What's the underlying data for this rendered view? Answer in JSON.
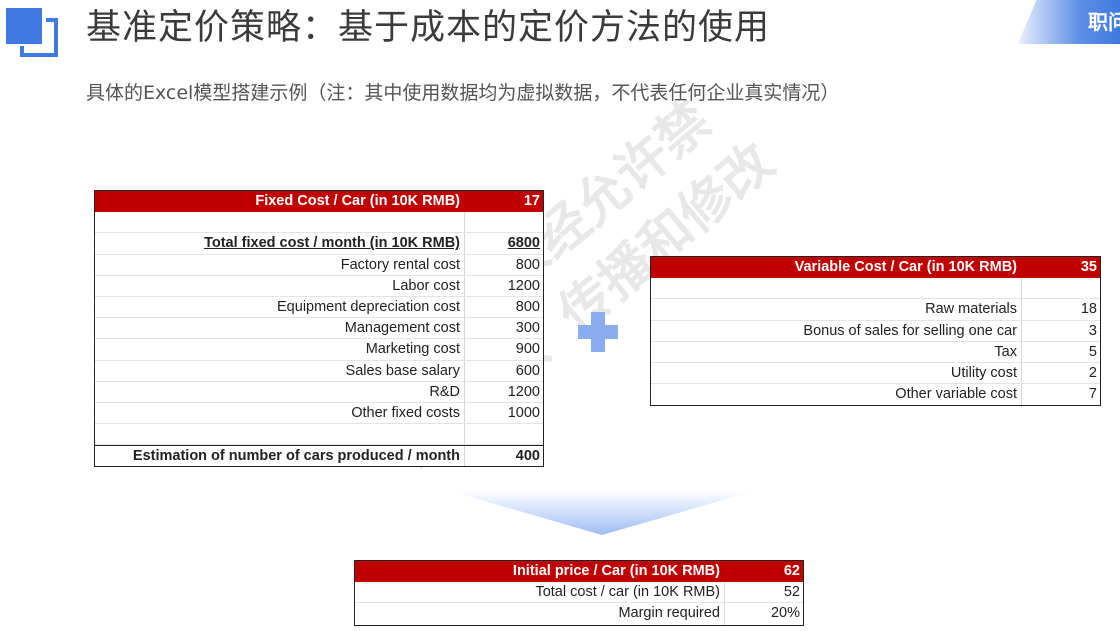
{
  "header": {
    "title": "基准定价策略：基于成本的定价方法的使用",
    "subtitle": "具体的Excel模型搭建示例（注：其中使用数据均为虚拟数据，不代表任何企业真实情况）",
    "brand_text": "职问"
  },
  "watermark": {
    "line1": "©职问™ 未经允许禁",
    "line2": "止复制、传播和修改"
  },
  "colors": {
    "header_red": "#c00000",
    "accent_blue": "#3f7ae0",
    "plus_blue": "#8aacf0"
  },
  "fixed_table": {
    "header_label": "Fixed Cost / Car (in 10K RMB)",
    "header_value": "17",
    "total_label": "Total fixed cost / month (in 10K RMB)",
    "total_value": "6800",
    "items": [
      {
        "label": "Factory rental cost",
        "value": "800"
      },
      {
        "label": "Labor cost",
        "value": "1200"
      },
      {
        "label": "Equipment depreciation cost",
        "value": "800"
      },
      {
        "label": "Management cost",
        "value": "300"
      },
      {
        "label": "Marketing cost",
        "value": "900"
      },
      {
        "label": "Sales base salary",
        "value": "600"
      },
      {
        "label": "R&D",
        "value": "1200"
      },
      {
        "label": "Other fixed costs",
        "value": "1000"
      }
    ],
    "estimation_label": "Estimation of number of cars produced / month",
    "estimation_value": "400"
  },
  "variable_table": {
    "header_label": "Variable Cost / Car (in 10K RMB)",
    "header_value": "35",
    "items": [
      {
        "label": "Raw materials",
        "value": "18"
      },
      {
        "label": "Bonus of sales for selling one car",
        "value": "3"
      },
      {
        "label": "Tax",
        "value": "5"
      },
      {
        "label": "Utility cost",
        "value": "2"
      },
      {
        "label": "Other variable cost",
        "value": "7"
      }
    ]
  },
  "result_table": {
    "header_label": "Initial price / Car (in 10K RMB)",
    "header_value": "62",
    "items": [
      {
        "label": "Total cost / car (in 10K RMB)",
        "value": "52"
      },
      {
        "label": "Margin required",
        "value": "20%"
      }
    ]
  }
}
